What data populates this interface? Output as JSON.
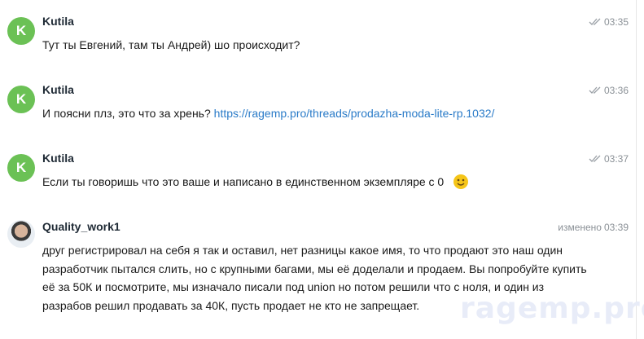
{
  "messages": [
    {
      "avatar_letter": "K",
      "author": "Kutila",
      "time": "03:35",
      "text": "Тут ты Евгений, там ты Андрей) шо происходит?"
    },
    {
      "avatar_letter": "K",
      "author": "Kutila",
      "time": "03:36",
      "text": "И поясни плз, это что за хрень?",
      "link": "https://ragemp.pro/threads/prodazha-moda-lite-rp.1032/"
    },
    {
      "avatar_letter": "K",
      "author": "Kutila",
      "time": "03:37",
      "text": "Если ты говоришь что это ваше и написано в единственном экземпляре с 0"
    },
    {
      "author": "Quality_work1",
      "edited_label": "изменено",
      "time": "03:39",
      "lines": [
        "друг регистрировал на себя я так и оставил, нет разницы какое имя, то что продают это наш один",
        "разработчик пытался слить, но с крупными багами, мы её доделали и продаем. Вы попробуйте купить",
        "её за 50К и посмотрите, мы изначало писали под union  но потом решили что с ноля, и один из",
        "разрабов решил продавать за 40К, пусть продает не кто не запрещает."
      ]
    }
  ],
  "watermark": "ragemp.pro",
  "colors": {
    "avatar_green": "#6bc155",
    "link": "#2a7bc8",
    "meta_gray": "#8a9096"
  }
}
